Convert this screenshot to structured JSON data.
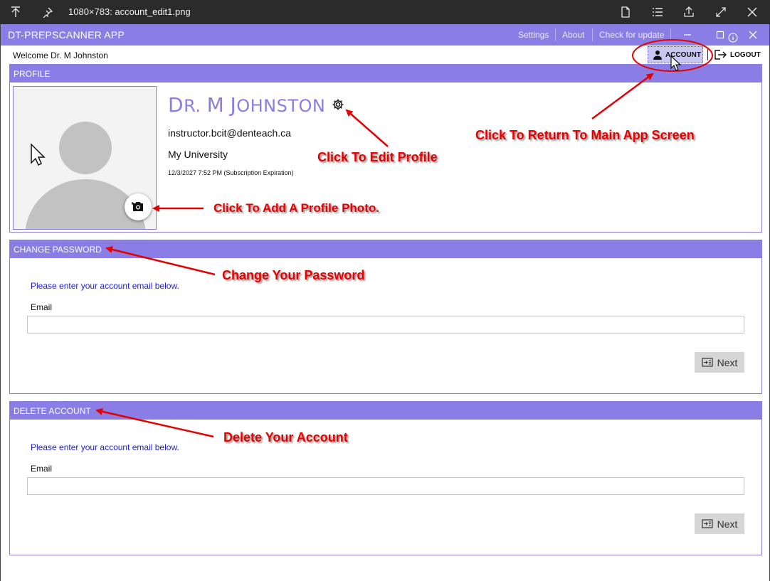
{
  "viewer": {
    "title": "1080×783: account_edit1.png"
  },
  "app": {
    "title": "DT-PREPSCANNER APP",
    "nav": [
      "Settings",
      "About",
      "Check for update"
    ]
  },
  "header": {
    "welcome": "Welcome Dr. M Johnston",
    "account_label": "ACCOUNT",
    "logout_label": "LOGOUT"
  },
  "profile": {
    "section_title": "PROFILE",
    "name_initial": "D",
    "name_rest_1": "R. ",
    "name_initial_2": "M",
    "name_initial_3": "J",
    "name_rest_2": "OHNSTON",
    "email": "instructor.bcit@denteach.ca",
    "organization": "My University",
    "expiration": "12/3/2027 7:52 PM (Subscription Expiration)"
  },
  "change_password": {
    "section_title": "CHANGE PASSWORD",
    "hint": "Please enter your account email below.",
    "email_label": "Email",
    "email_value": "",
    "next_label": "Next"
  },
  "delete_account": {
    "section_title": "DELETE ACCOUNT",
    "hint": "Please enter your account email below.",
    "email_label": "Email",
    "email_value": "",
    "next_label": "Next"
  },
  "annotations": {
    "return_main": "Click To Return To Main App Screen",
    "edit_profile": "Click To Edit Profile",
    "add_photo": "Click To Add A Profile Photo.",
    "change_password": "Change Your Password",
    "delete_account": "Delete Your Account"
  },
  "colors": {
    "accent": "#8a7ee6",
    "annotation": "#e60000",
    "hint": "#1a1ae6"
  },
  "icons": [
    "upload-icon",
    "pin-icon",
    "file-icon",
    "list-icon",
    "share-icon",
    "expand-icon",
    "close-icon",
    "user-icon",
    "logout-icon",
    "gear-icon",
    "camera-icon",
    "next-icon",
    "info-icon",
    "minimize-icon",
    "maximize-icon"
  ]
}
